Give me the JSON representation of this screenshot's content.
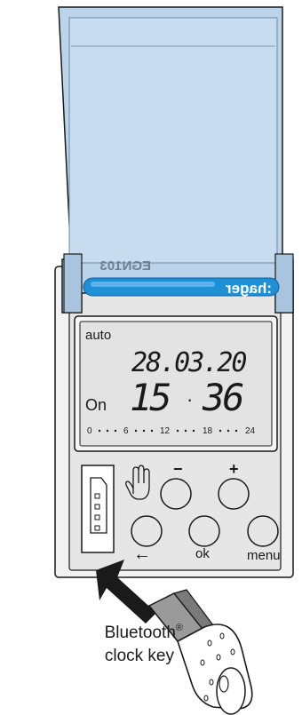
{
  "device": {
    "model_mirrored": "EGN103",
    "brand_mirrored": ":hager"
  },
  "display": {
    "mode": "auto",
    "date": "28.03.20",
    "state": "On",
    "time_hours": "15",
    "time_minutes": "36",
    "timeline": [
      "0",
      "6",
      "12",
      "18",
      "24"
    ]
  },
  "buttons": {
    "minus": "−",
    "plus": "+",
    "back_arrow": "←",
    "ok": "ok",
    "menu": "menu"
  },
  "caption": {
    "line1": "Bluetooth",
    "reg": "®",
    "line2": "clock key"
  },
  "colors": {
    "cover_fill": "#bfd6ea",
    "cover_stroke": "#1a1a1a",
    "brand_bar": "#1f8fd6",
    "body_fill": "#e8e8e8",
    "screen_fill": "#d9d9d9"
  }
}
